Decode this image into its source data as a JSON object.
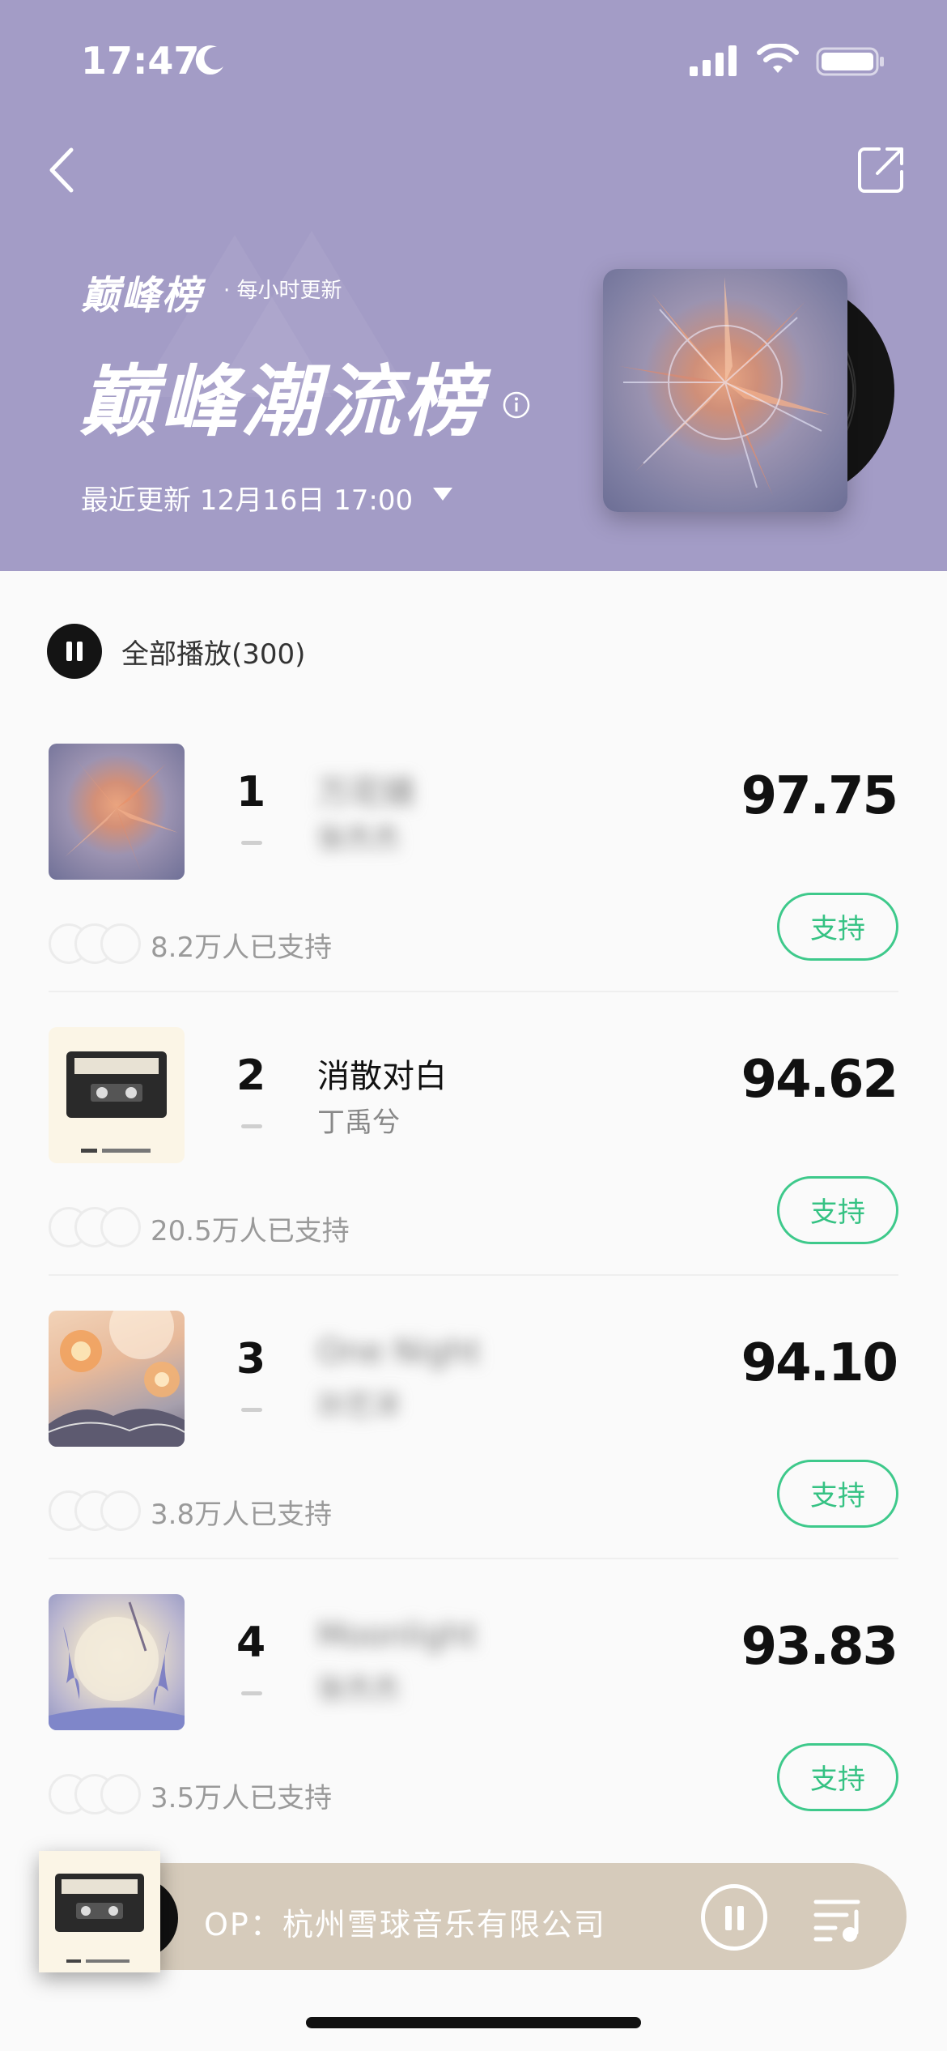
{
  "status_bar": {
    "time": "17:47"
  },
  "header": {
    "brand": "巅峰榜",
    "brand_sub": "· 每小时更新",
    "title": "巅峰潮流榜",
    "update_text": "最近更新 12月16日 17:00",
    "bg_color": "#a39cc6"
  },
  "play_all": {
    "label": "全部播放(300)"
  },
  "songs": [
    {
      "rank": "1",
      "title": "万花镜",
      "artist": "张杰杰",
      "score": "97.75",
      "support": "8.2万人已支持",
      "support_label": "支持"
    },
    {
      "rank": "2",
      "title": "消散对白",
      "artist": "丁禹兮",
      "score": "94.62",
      "support": "20.5万人已支持",
      "support_label": "支持"
    },
    {
      "rank": "3",
      "title": "One Night",
      "artist": "孙艺洋",
      "score": "94.10",
      "support": "3.8万人已支持",
      "support_label": "支持"
    },
    {
      "rank": "4",
      "title": "Moonlight",
      "artist": "张杰杰",
      "score": "93.83",
      "support": "3.5万人已支持",
      "support_label": "支持"
    }
  ],
  "mini_player": {
    "text": "OP：杭州雪球音乐有限公司"
  },
  "colors": {
    "accent_green": "#3ec98b",
    "header": "#a39cc6",
    "mini_player": "#d6cbbb"
  }
}
